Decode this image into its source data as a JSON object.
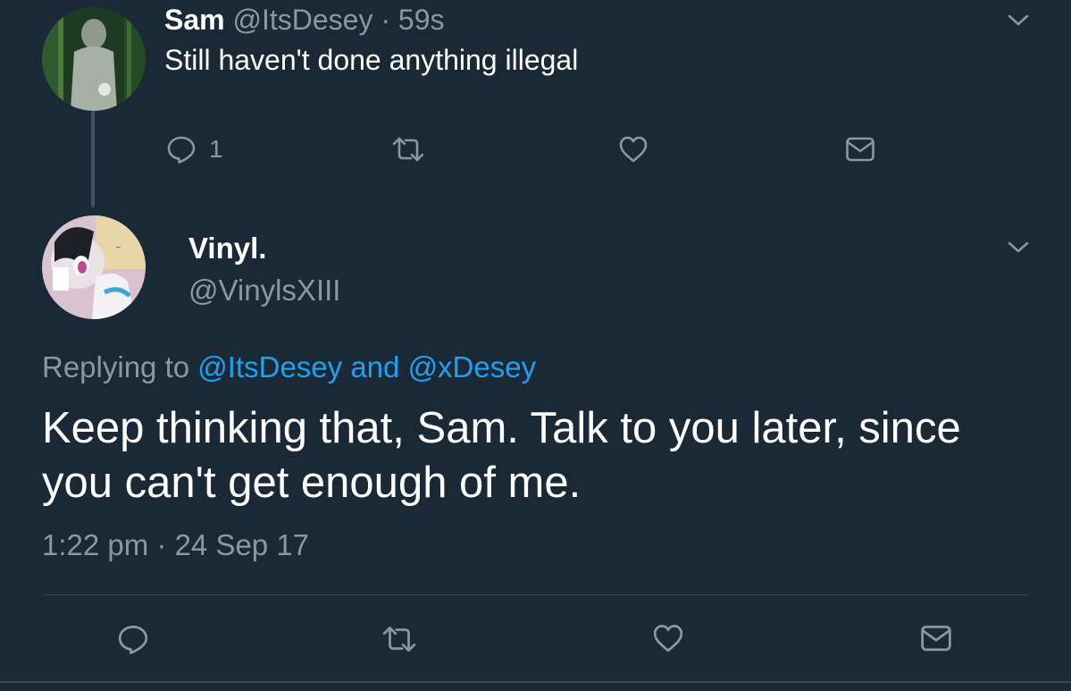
{
  "colors": {
    "background": "#1b2836",
    "text_primary": "#ffffff",
    "text_secondary": "#8899a6",
    "link": "#1da1f2",
    "divider": "#38444d"
  },
  "reply_tweet": {
    "name": "Sam",
    "handle": "@ItsDesey",
    "time": "· 59s",
    "text": "Still haven't done anything illegal",
    "reply_count": "1",
    "icons": [
      "reply-icon",
      "retweet-icon",
      "like-icon",
      "dm-icon",
      "chevron-down-icon"
    ]
  },
  "main_tweet": {
    "name": "Vinyl.",
    "handle": "@VinylsXIII",
    "replying_prefix": "Replying to",
    "replying_mention_1": "@ItsDesey",
    "replying_joiner": "and",
    "replying_mention_2": "@xDesey",
    "text": "Keep thinking that, Sam. Talk to you later, since you can't get enough of me.",
    "timestamp": "1:22 pm · 24 Sep 17",
    "icons": [
      "reply-icon",
      "retweet-icon",
      "like-icon",
      "dm-icon",
      "chevron-down-icon"
    ]
  }
}
